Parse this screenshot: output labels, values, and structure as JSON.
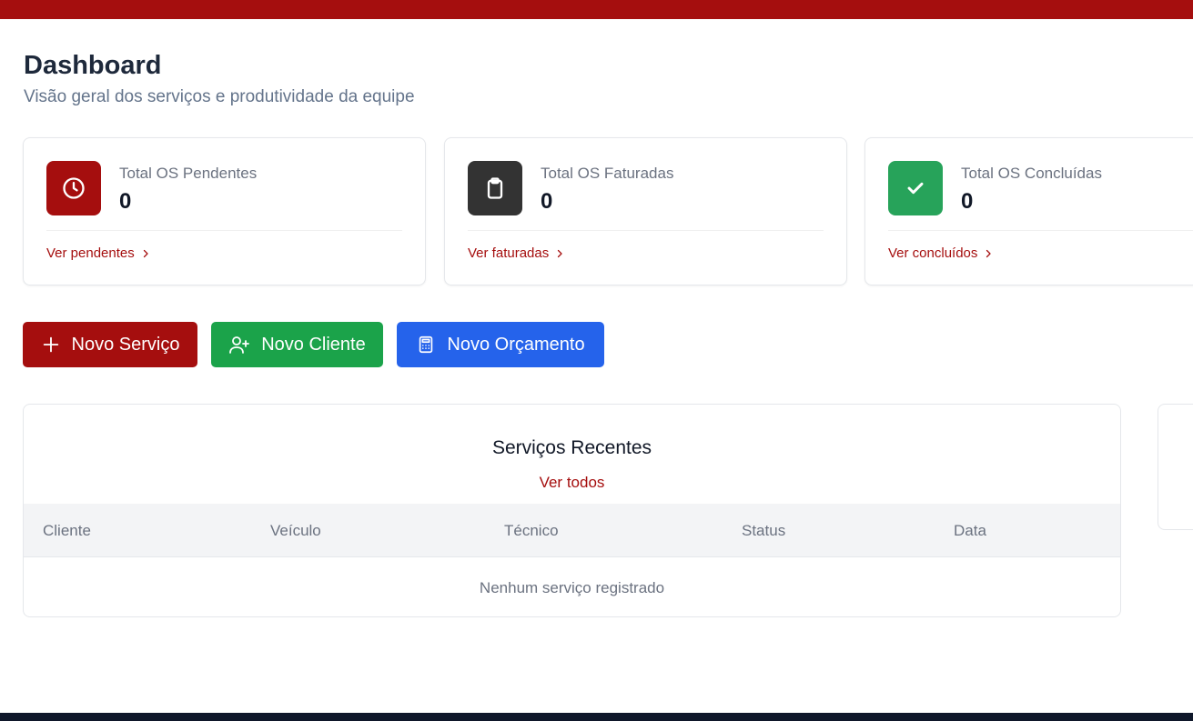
{
  "header": {
    "title": "Dashboard",
    "subtitle": "Visão geral dos serviços e produtividade da equipe"
  },
  "cards": [
    {
      "label": "Total OS Pendentes",
      "value": "0",
      "link": "Ver pendentes",
      "icon": "clock-icon",
      "color": "#a50e0e"
    },
    {
      "label": "Total OS Faturadas",
      "value": "0",
      "link": "Ver faturadas",
      "icon": "clipboard-icon",
      "color": "#333333"
    },
    {
      "label": "Total OS Concluídas",
      "value": "0",
      "link": "Ver concluídos",
      "icon": "check-icon",
      "color": "#27a35a"
    }
  ],
  "actions": {
    "new_service": "Novo Serviço",
    "new_client": "Novo Cliente",
    "new_quote": "Novo Orçamento"
  },
  "colors": {
    "brand": "#a50e0e",
    "green": "#1ba34a",
    "blue": "#2563eb",
    "footer": "#0f172a"
  },
  "recent": {
    "title": "Serviços Recentes",
    "view_all": "Ver todos",
    "columns": [
      "Cliente",
      "Veículo",
      "Técnico",
      "Status",
      "Data"
    ],
    "empty": "Nenhum serviço registrado"
  }
}
